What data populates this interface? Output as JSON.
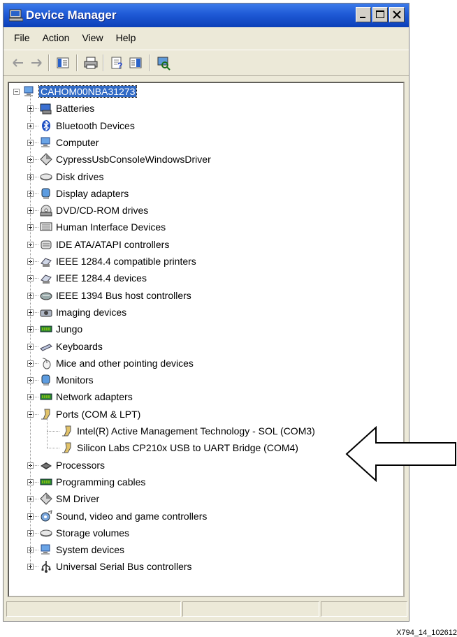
{
  "window": {
    "title": "Device Manager"
  },
  "menu": [
    "File",
    "Action",
    "View",
    "Help"
  ],
  "tree": {
    "root": "CAHOM00NBA31273",
    "categories": [
      {
        "label": "Batteries",
        "icon": "battery-icon"
      },
      {
        "label": "Bluetooth Devices",
        "icon": "bluetooth-icon"
      },
      {
        "label": "Computer",
        "icon": "computer-icon"
      },
      {
        "label": "CypressUsbConsoleWindowsDriver",
        "icon": "diamond-icon"
      },
      {
        "label": "Disk drives",
        "icon": "disk-drive-icon"
      },
      {
        "label": "Display adapters",
        "icon": "display-adapter-icon"
      },
      {
        "label": "DVD/CD-ROM drives",
        "icon": "cdrom-icon"
      },
      {
        "label": "Human Interface Devices",
        "icon": "hid-icon"
      },
      {
        "label": "IDE ATA/ATAPI controllers",
        "icon": "ide-controller-icon"
      },
      {
        "label": "IEEE 1284.4 compatible printers",
        "icon": "printer-icon"
      },
      {
        "label": "IEEE 1284.4 devices",
        "icon": "printer-icon"
      },
      {
        "label": "IEEE 1394 Bus host controllers",
        "icon": "firewire-icon"
      },
      {
        "label": "Imaging devices",
        "icon": "camera-icon"
      },
      {
        "label": "Jungo",
        "icon": "board-icon"
      },
      {
        "label": "Keyboards",
        "icon": "keyboard-icon"
      },
      {
        "label": "Mice and other pointing devices",
        "icon": "mouse-icon"
      },
      {
        "label": "Monitors",
        "icon": "monitor-icon"
      },
      {
        "label": "Network adapters",
        "icon": "board-icon"
      },
      {
        "label": "Ports (COM & LPT)",
        "icon": "port-icon",
        "expanded": true,
        "children": [
          {
            "label": "Intel(R) Active Management Technology - SOL (COM3)",
            "icon": "port-icon"
          },
          {
            "label": "Silicon Labs CP210x USB to UART Bridge (COM4)",
            "icon": "port-icon"
          }
        ]
      },
      {
        "label": "Processors",
        "icon": "processor-icon"
      },
      {
        "label": "Programming cables",
        "icon": "board-icon"
      },
      {
        "label": "SM Driver",
        "icon": "diamond-icon"
      },
      {
        "label": "Sound, video and game controllers",
        "icon": "sound-icon"
      },
      {
        "label": "Storage volumes",
        "icon": "disk-drive-icon"
      },
      {
        "label": "System devices",
        "icon": "computer-icon"
      },
      {
        "label": "Universal Serial Bus controllers",
        "icon": "usb-icon"
      }
    ]
  },
  "caption": "X794_14_102612"
}
